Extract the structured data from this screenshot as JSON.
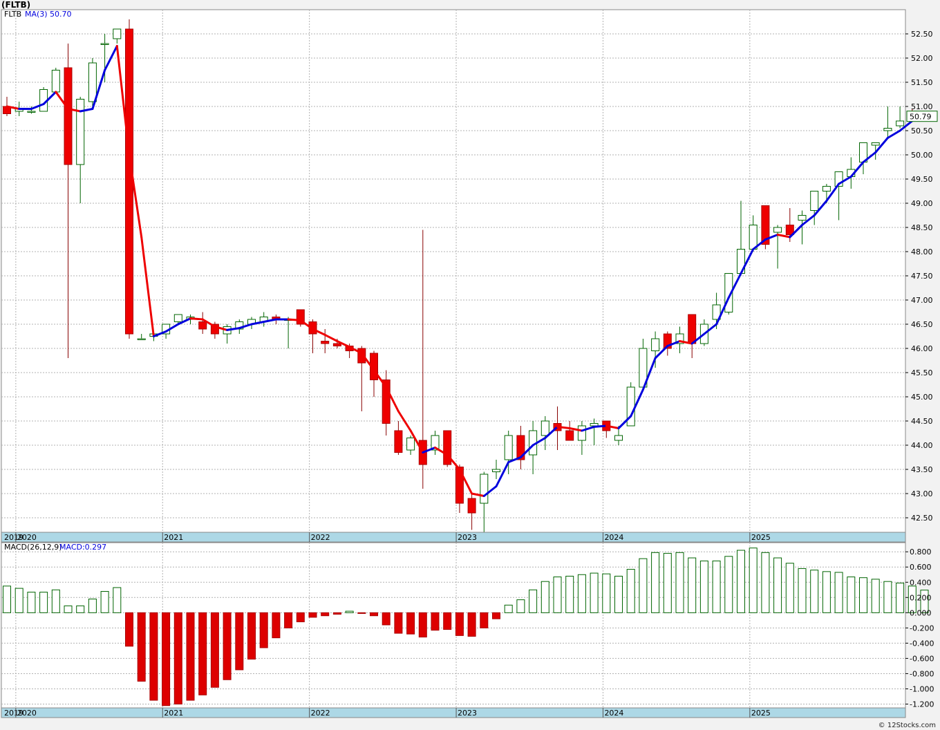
{
  "title": "(FLTB)",
  "copyright": "© 12Stocks.com",
  "colors": {
    "up_candle_stroke": "#006400",
    "down_candle_fill": "#ee0000",
    "ma_up": "#0000dd",
    "ma_down": "#ee0000",
    "macd_pos_stroke": "#006400",
    "macd_neg_fill": "#dd0000",
    "axis_bar": "#add8e6"
  },
  "price_panel": {
    "legend_symbol": "FLTB",
    "legend_ma": "MA(3)",
    "legend_ma_value": "50.70",
    "last_price_label": "50.79",
    "y_ticks": [
      "42.50",
      "43.00",
      "43.50",
      "44.00",
      "44.50",
      "45.00",
      "45.50",
      "46.00",
      "46.50",
      "47.00",
      "47.50",
      "48.00",
      "48.50",
      "49.00",
      "49.50",
      "50.00",
      "50.50",
      "51.00",
      "51.50",
      "52.00",
      "52.50"
    ],
    "year_labels": [
      "2019",
      "2020",
      "2021",
      "2022",
      "2023",
      "2024",
      "2025"
    ]
  },
  "macd_panel": {
    "legend_label": "MACD(26,12,9)",
    "legend_value": "MACD:0.297",
    "y_ticks": [
      "-1.200",
      "-1.000",
      "-0.800",
      "-0.600",
      "-0.400",
      "-0.200",
      "0.000",
      "0.200",
      "0.400",
      "0.600",
      "0.800"
    ],
    "year_labels": [
      "2019",
      "2020",
      "2021",
      "2022",
      "2023",
      "2024",
      "2025"
    ]
  },
  "chart_data": [
    {
      "type": "candlestick",
      "title": "(FLTB)",
      "interval": "monthly",
      "start": "2019-12",
      "x_range": [
        "2019-12",
        "2025-09"
      ],
      "ylim": [
        42.2,
        53.0
      ],
      "grid": true,
      "legend_placement": "top-left",
      "ohlc": [
        [
          51.0,
          51.2,
          50.8,
          50.85
        ],
        [
          50.9,
          51.1,
          50.8,
          50.95
        ],
        [
          50.9,
          51.0,
          50.85,
          50.9
        ],
        [
          50.9,
          51.4,
          50.9,
          51.35
        ],
        [
          51.3,
          51.8,
          51.3,
          51.75
        ],
        [
          51.8,
          52.3,
          45.8,
          49.8
        ],
        [
          49.8,
          51.2,
          49.0,
          51.15
        ],
        [
          51.1,
          52.0,
          51.0,
          51.9
        ],
        [
          52.3,
          52.5,
          51.5,
          52.3
        ],
        [
          52.4,
          52.6,
          52.3,
          52.6
        ],
        [
          52.6,
          52.8,
          46.2,
          46.3
        ],
        [
          46.2,
          46.3,
          46.2,
          46.2
        ],
        [
          46.25,
          46.3,
          46.15,
          46.3
        ],
        [
          46.3,
          46.5,
          46.2,
          46.5
        ],
        [
          46.55,
          46.7,
          46.5,
          46.7
        ],
        [
          46.6,
          46.7,
          46.5,
          46.65
        ],
        [
          46.55,
          46.75,
          46.3,
          46.4
        ],
        [
          46.5,
          46.55,
          46.2,
          46.3
        ],
        [
          46.3,
          46.5,
          46.1,
          46.45
        ],
        [
          46.4,
          46.6,
          46.3,
          46.55
        ],
        [
          46.5,
          46.65,
          46.4,
          46.6
        ],
        [
          46.55,
          46.75,
          46.45,
          46.65
        ],
        [
          46.65,
          46.7,
          46.5,
          46.6
        ],
        [
          46.6,
          46.65,
          46.0,
          46.6
        ],
        [
          46.8,
          46.8,
          46.45,
          46.5
        ],
        [
          46.55,
          46.6,
          45.9,
          46.3
        ],
        [
          46.15,
          46.4,
          45.9,
          46.1
        ],
        [
          46.1,
          46.2,
          46.0,
          46.05
        ],
        [
          46.05,
          46.1,
          45.8,
          45.95
        ],
        [
          46.0,
          46.05,
          44.7,
          45.7
        ],
        [
          45.9,
          45.95,
          45.0,
          45.35
        ],
        [
          45.35,
          45.55,
          44.2,
          44.45
        ],
        [
          44.3,
          44.5,
          43.8,
          43.85
        ],
        [
          43.9,
          44.2,
          43.8,
          44.15
        ],
        [
          44.1,
          48.45,
          43.1,
          43.6
        ],
        [
          43.9,
          44.3,
          43.8,
          44.2
        ],
        [
          44.3,
          44.3,
          43.55,
          43.6
        ],
        [
          43.55,
          43.6,
          42.6,
          42.8
        ],
        [
          42.9,
          43.0,
          42.25,
          42.6
        ],
        [
          42.8,
          43.45,
          42.2,
          43.4
        ],
        [
          43.45,
          43.7,
          43.3,
          43.5
        ],
        [
          43.7,
          44.3,
          43.4,
          44.2
        ],
        [
          44.2,
          44.4,
          43.5,
          43.7
        ],
        [
          43.8,
          44.5,
          43.4,
          44.3
        ],
        [
          44.2,
          44.6,
          43.9,
          44.5
        ],
        [
          44.45,
          44.8,
          43.9,
          44.3
        ],
        [
          44.3,
          44.5,
          44.1,
          44.1
        ],
        [
          44.1,
          44.5,
          43.8,
          44.4
        ],
        [
          44.4,
          44.55,
          44.0,
          44.45
        ],
        [
          44.5,
          44.5,
          44.15,
          44.3
        ],
        [
          44.1,
          44.4,
          44.0,
          44.2
        ],
        [
          44.4,
          45.3,
          44.4,
          45.2
        ],
        [
          45.2,
          46.2,
          45.2,
          46.0
        ],
        [
          45.95,
          46.35,
          45.6,
          46.2
        ],
        [
          46.3,
          46.35,
          45.85,
          46.0
        ],
        [
          46.1,
          46.45,
          45.9,
          46.3
        ],
        [
          46.7,
          46.7,
          45.8,
          46.1
        ],
        [
          46.1,
          46.6,
          46.05,
          46.5
        ],
        [
          46.6,
          47.15,
          46.4,
          46.9
        ],
        [
          46.75,
          47.55,
          46.7,
          47.55
        ],
        [
          47.55,
          49.05,
          47.5,
          48.05
        ],
        [
          48.05,
          48.75,
          48.0,
          48.55
        ],
        [
          48.95,
          48.95,
          48.05,
          48.15
        ],
        [
          48.4,
          48.55,
          47.65,
          48.5
        ],
        [
          48.55,
          48.9,
          48.2,
          48.35
        ],
        [
          48.65,
          48.85,
          48.15,
          48.75
        ],
        [
          48.85,
          49.25,
          48.55,
          49.25
        ],
        [
          49.25,
          49.4,
          49.0,
          49.35
        ],
        [
          49.35,
          49.6,
          48.65,
          49.65
        ],
        [
          49.55,
          49.95,
          49.3,
          49.7
        ],
        [
          49.85,
          50.25,
          49.6,
          50.25
        ],
        [
          50.2,
          50.25,
          49.9,
          50.25
        ],
        [
          50.5,
          51.0,
          50.35,
          50.55
        ],
        [
          50.6,
          51.0,
          50.55,
          50.7
        ],
        [
          50.8,
          50.95,
          50.7,
          50.79
        ]
      ],
      "ma3": [
        51.0,
        50.95,
        50.95,
        51.05,
        51.3,
        50.95,
        50.9,
        50.95,
        51.75,
        52.25,
        50.0,
        48.3,
        46.25,
        46.35,
        46.5,
        46.62,
        46.6,
        46.45,
        46.38,
        46.42,
        46.5,
        46.55,
        46.6,
        46.6,
        46.58,
        46.4,
        46.28,
        46.15,
        46.03,
        45.9,
        45.55,
        45.2,
        44.7,
        44.3,
        43.85,
        43.95,
        43.8,
        43.5,
        43.0,
        42.95,
        43.15,
        43.65,
        43.75,
        44.0,
        44.15,
        44.38,
        44.35,
        44.3,
        44.38,
        44.4,
        44.35,
        44.6,
        45.15,
        45.8,
        46.05,
        46.15,
        46.1,
        46.3,
        46.5,
        47.05,
        47.55,
        48.05,
        48.25,
        48.35,
        48.3,
        48.55,
        48.75,
        49.05,
        49.4,
        49.55,
        49.85,
        50.05,
        50.35,
        50.5,
        50.7
      ]
    },
    {
      "type": "bar",
      "title": "MACD(26,12,9)",
      "ylim": [
        -1.25,
        0.92
      ],
      "grid": true,
      "values": [
        0.35,
        0.32,
        0.27,
        0.27,
        0.3,
        0.09,
        0.09,
        0.18,
        0.28,
        0.33,
        -0.44,
        -0.9,
        -1.15,
        -1.22,
        -1.2,
        -1.15,
        -1.08,
        -0.98,
        -0.88,
        -0.75,
        -0.61,
        -0.46,
        -0.33,
        -0.2,
        -0.12,
        -0.06,
        -0.04,
        -0.02,
        0.02,
        -0.01,
        -0.04,
        -0.16,
        -0.27,
        -0.28,
        -0.32,
        -0.23,
        -0.22,
        -0.3,
        -0.31,
        -0.2,
        -0.08,
        0.1,
        0.17,
        0.3,
        0.41,
        0.47,
        0.48,
        0.5,
        0.52,
        0.51,
        0.48,
        0.57,
        0.71,
        0.79,
        0.78,
        0.79,
        0.72,
        0.68,
        0.68,
        0.74,
        0.82,
        0.85,
        0.79,
        0.72,
        0.65,
        0.58,
        0.56,
        0.54,
        0.53,
        0.47,
        0.46,
        0.44,
        0.41,
        0.39,
        0.35,
        0.297
      ]
    }
  ]
}
